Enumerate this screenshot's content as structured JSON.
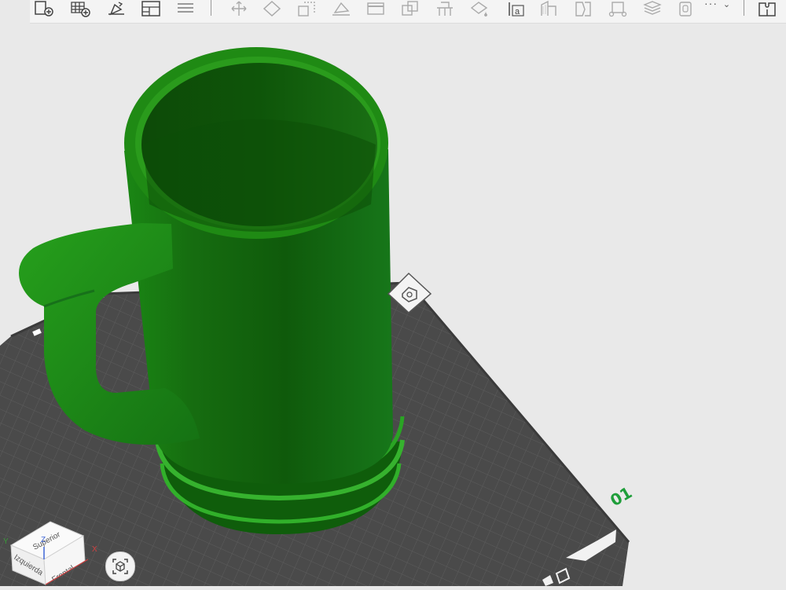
{
  "toolbar": {
    "more_label": "···",
    "items": [
      {
        "name": "add-object",
        "icon": "add-object-icon"
      },
      {
        "name": "add-plate",
        "icon": "add-plate-icon"
      },
      {
        "name": "auto-orient",
        "icon": "auto-orient-icon"
      },
      {
        "name": "arrange",
        "icon": "arrange-icon"
      },
      {
        "name": "layers",
        "icon": "layers-icon"
      },
      {
        "name": "move",
        "icon": "move-icon"
      },
      {
        "name": "rotate",
        "icon": "rotate-icon"
      },
      {
        "name": "scale",
        "icon": "scale-icon"
      },
      {
        "name": "lay-on-face",
        "icon": "lay-on-face-icon"
      },
      {
        "name": "cut",
        "icon": "cut-icon"
      },
      {
        "name": "boolean",
        "icon": "boolean-icon"
      },
      {
        "name": "support-paint",
        "icon": "support-paint-icon"
      },
      {
        "name": "color-paint",
        "icon": "color-paint-icon"
      },
      {
        "name": "text",
        "icon": "text-icon"
      },
      {
        "name": "seam-paint",
        "icon": "seam-paint-icon"
      },
      {
        "name": "split",
        "icon": "split-icon"
      },
      {
        "name": "measure",
        "icon": "measure-icon"
      },
      {
        "name": "variable-layer",
        "icon": "variable-layer-icon"
      },
      {
        "name": "assembly",
        "icon": "assembly-icon"
      }
    ],
    "right_icon": "puzzle-icon"
  },
  "viewport": {
    "plate_number": "01",
    "model_color": "#1b7a12",
    "plate_color": "#4a4a4a",
    "grid_color": "#5e5e5e",
    "accent": "#1f9e3a"
  },
  "nav_cube": {
    "top": "Superior",
    "left": "Izquierda",
    "front": "Frontal",
    "axis_x": "X",
    "axis_y": "Y",
    "axis_z": "Z"
  }
}
